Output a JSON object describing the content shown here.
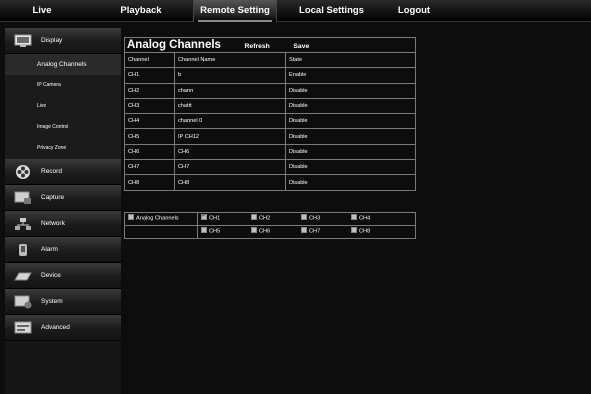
{
  "topnav": {
    "tabs": [
      "Live",
      "Playback",
      "Remote Setting",
      "Local Settings",
      "Logout"
    ],
    "active": "Remote Setting"
  },
  "sidebar": {
    "sections": [
      {
        "label": "Display",
        "icon": "monitor-icon"
      },
      {
        "label": "Record",
        "icon": "film-reel-icon"
      },
      {
        "label": "Capture",
        "icon": "capture-icon"
      },
      {
        "label": "Network",
        "icon": "network-icon"
      },
      {
        "label": "Alarm",
        "icon": "alarm-icon"
      },
      {
        "label": "Device",
        "icon": "hard-disk-icon"
      },
      {
        "label": "System",
        "icon": "system-icon"
      },
      {
        "label": "Advanced",
        "icon": "advanced-icon"
      }
    ],
    "display_subitems": [
      "Analog Channels",
      "IP Camera",
      "Live",
      "Image Control",
      "Privacy Zone"
    ],
    "selected_subitem": "Analog Channels"
  },
  "main": {
    "title": "Analog Channels",
    "refresh_label": "Refresh",
    "save_label": "Save",
    "columns": [
      "Channel",
      "Channel Name",
      "State"
    ],
    "rows": [
      [
        "CH1",
        "b",
        "Enable"
      ],
      [
        "CH2",
        "chann",
        "Disable"
      ],
      [
        "CH3",
        "chattt",
        "Disable"
      ],
      [
        "CH4",
        "channel 0",
        "Disable"
      ],
      [
        "CH5",
        "IP CH12",
        "Disable"
      ],
      [
        "CH6",
        "CH6",
        "Disable"
      ],
      [
        "CH7",
        "CH7",
        "Disable"
      ],
      [
        "CH8",
        "CH8",
        "Disable"
      ]
    ],
    "selector": {
      "all_label": "Analog Channels",
      "all_checked": false,
      "channels": [
        {
          "label": "CH1",
          "checked": true
        },
        {
          "label": "CH2",
          "checked": false
        },
        {
          "label": "CH3",
          "checked": false
        },
        {
          "label": "CH4",
          "checked": false
        },
        {
          "label": "CH5",
          "checked": false
        },
        {
          "label": "CH6",
          "checked": false
        },
        {
          "label": "CH7",
          "checked": false
        },
        {
          "label": "CH8",
          "checked": false
        }
      ]
    }
  }
}
